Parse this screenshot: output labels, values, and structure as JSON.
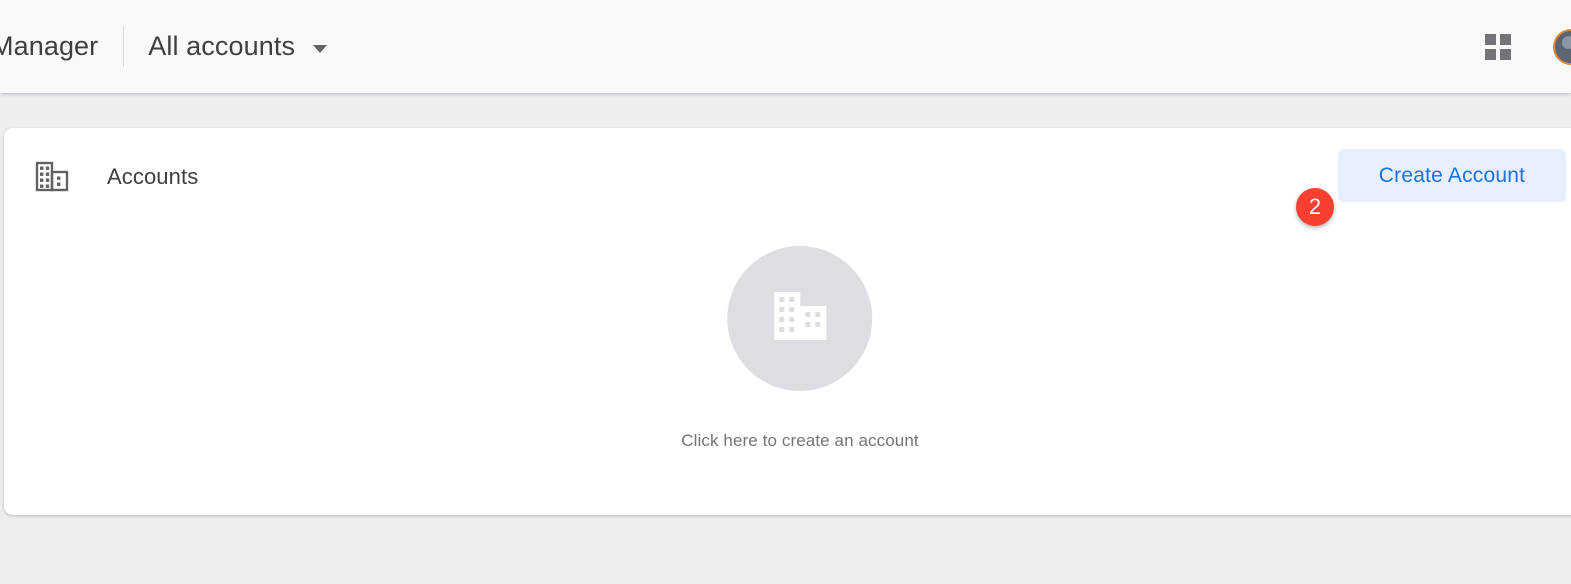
{
  "header": {
    "product_title": "Manager",
    "account_selector": {
      "label": "All accounts",
      "caret_icon": "chevron-down-icon"
    },
    "apps_icon": "apps-grid-icon",
    "avatar_icon": "user-avatar"
  },
  "card": {
    "title": "Accounts",
    "title_icon": "domain-building-icon",
    "create_account_label": "Create Account",
    "step_badge": "2",
    "empty_state": {
      "icon": "domain-building-icon",
      "message": "Click here to create an account"
    }
  },
  "colors": {
    "accent_blue": "#1a73e8",
    "button_bg": "#e8f0fe",
    "badge_red": "#f93f2f",
    "text_primary": "#3c4043",
    "text_secondary": "#70757a",
    "page_bg": "#eceef0",
    "header_bg": "#f9f9fa",
    "empty_circle": "#dcdee1"
  }
}
